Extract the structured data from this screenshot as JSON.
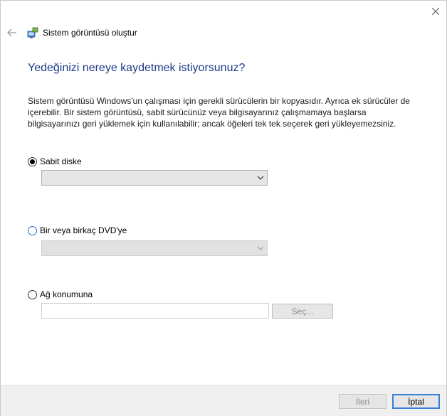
{
  "window": {
    "title": "Sistem görüntüsü oluştur",
    "icons": {
      "close": "close-icon",
      "back": "back-arrow-icon",
      "app": "system-image-icon"
    }
  },
  "main": {
    "heading": "Yedeğinizi nereye kaydetmek istiyorsunuz?",
    "description": "Sistem görüntüsü Windows'un çalışması için gerekli sürücülerin bir kopyasıdır. Ayrıca ek sürücüler de içerebilir. Bir sistem görüntüsü, sabit sürücünüz veya bilgisayarınız çalışmamaya başlarsa bilgisayarınızı geri yüklemek için kullanılabilir; ancak öğeleri tek tek seçerek geri yükleyemezsiniz.",
    "options": {
      "hard_disk": {
        "label": "Sabit diske",
        "selected": true,
        "dropdown_value": ""
      },
      "dvd": {
        "label": "Bir veya birkaç DVD'ye",
        "selected": false,
        "dropdown_value": ""
      },
      "network": {
        "label": "Ağ konumuna",
        "selected": false,
        "path_value": "",
        "browse_label": "Seç..."
      }
    }
  },
  "footer": {
    "next_label": "İleri",
    "cancel_label": "İptal"
  },
  "colors": {
    "heading": "#1e3b8a",
    "focus": "#3c7fd7"
  }
}
